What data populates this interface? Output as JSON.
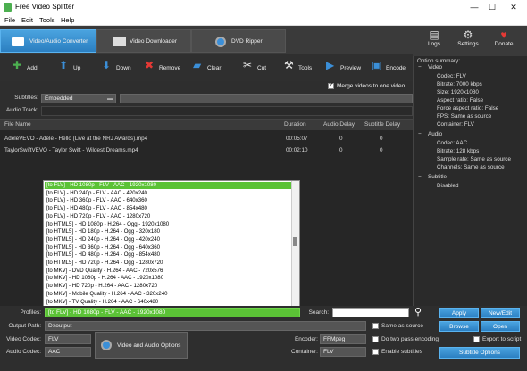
{
  "window": {
    "title": "Free Video Splitter"
  },
  "menu": [
    "File",
    "Edit",
    "Tools",
    "Help"
  ],
  "tabs": [
    "Video/Audio Converter",
    "Video Downloader",
    "DVD Ripper"
  ],
  "top_right": [
    {
      "label": "Logs",
      "icon": "logs-icon"
    },
    {
      "label": "Settings",
      "icon": "gear-icon"
    },
    {
      "label": "Donate",
      "icon": "heart-icon"
    }
  ],
  "toolbar": [
    {
      "label": "Add",
      "icon": "plus-icon"
    },
    {
      "label": "Up",
      "icon": "arrow-up-icon"
    },
    {
      "label": "Down",
      "icon": "arrow-down-icon"
    },
    {
      "label": "Remove",
      "icon": "remove-icon"
    },
    {
      "label": "Clear",
      "icon": "eraser-icon"
    },
    {
      "label": "Cut",
      "icon": "scissors-icon"
    },
    {
      "label": "Tools",
      "icon": "tools-icon"
    },
    {
      "label": "Preview",
      "icon": "play-icon"
    },
    {
      "label": "Encode",
      "icon": "film-icon"
    }
  ],
  "merge": {
    "label": "Merge videos to one video",
    "checked": true
  },
  "subtitles": {
    "label": "Subtitles:",
    "value": "Embedded"
  },
  "audio_track": {
    "label": "Audio Track:"
  },
  "table": {
    "headers": [
      "File Name",
      "Duration",
      "Audio Delay",
      "Subtitle Delay"
    ],
    "rows": [
      [
        "AdeleVEVO - Adele - Hello (Live at the NRJ Awards).mp4",
        "00:05:07",
        "0",
        "0"
      ],
      [
        "TaylorSwiftVEVO - Taylor Swift - Wildest Dreams.mp4",
        "00:02:10",
        "0",
        "0"
      ]
    ]
  },
  "profiles_list": [
    "[to FLV] - HD 1080p - FLV - AAC - 1920x1080",
    "[to FLV] - HD 240p - FLV - AAC - 420x240",
    "[to FLV] - HD 360p - FLV - AAC - 640x360",
    "[to FLV] - HD 480p - FLV - AAC - 854x480",
    "[to FLV] - HD 720p - FLV - AAC - 1280x720",
    "[to HTML5] - HD 1080p - H.264 - Ogg - 1920x1080",
    "[to HTML5] - HD 180p - H.264 - Ogg - 320x180",
    "[to HTML5] - HD 240p - H.264 - Ogg - 420x240",
    "[to HTML5] - HD 360p - H.264 - Ogg - 640x360",
    "[to HTML5] - HD 480p - H.264 - Ogg - 854x480",
    "[to HTML5] - HD 720p - H.264 - Ogg - 1280x720",
    "[to MKV] - DVD Quality - H.264 - AAC - 720x576",
    "[to MKV] - HD 1080p - H.264 - AAC - 1920x1080",
    "[to MKV] - HD 720p - H.264 - AAC - 1280x720",
    "[to MKV] - Mobile Quality - H.264 - AAC - 320x240",
    "[to MKV] - TV Quality - H.264 - AAC - 640x480"
  ],
  "profiles": {
    "label": "Profiles:",
    "value": "[to FLV] - HD 1080p - FLV - AAC - 1920x1080"
  },
  "search": {
    "label": "Search:"
  },
  "output_path": {
    "label": "Output Path:",
    "value": "D:\\output"
  },
  "video_codec": {
    "label": "Video Codec:",
    "value": "FLV"
  },
  "audio_codec": {
    "label": "Audio Codec:",
    "value": "AAC"
  },
  "av_options": "Video and Audio Options",
  "encoder": {
    "label": "Encoder:",
    "value": "FFMpeg"
  },
  "container": {
    "label": "Container:",
    "value": "FLV"
  },
  "checks": {
    "same_as_source": "Same as source",
    "two_pass": "Do two pass encoding",
    "enable_subtitles": "Enable subtitles",
    "export_script": "Export to script"
  },
  "buttons": {
    "apply": "Apply",
    "new_edit": "New/Edit",
    "browse": "Browse",
    "open": "Open",
    "subtitle_options": "Subtitle Options"
  },
  "option_summary": {
    "title": "Option summary:",
    "video": {
      "label": "Video",
      "lines": [
        "Codec: FLV",
        "Bitrate: 7000 kbps",
        "Size: 1920x1080",
        "Aspect ratio: False",
        "Force aspect ratio: False",
        "FPS: Same as source",
        "Container: FLV"
      ]
    },
    "audio": {
      "label": "Audio",
      "lines": [
        "Codec: AAC",
        "Bitrate: 128 kbps",
        "Sample rate: Same as source",
        "Channels: Same as source"
      ]
    },
    "subtitle": {
      "label": "Subtitle",
      "lines": [
        "Disabled"
      ]
    }
  },
  "colors": {
    "accent_blue": "#2b7fc1",
    "selection_green": "#5bc236",
    "background": "#2e2e2e"
  }
}
